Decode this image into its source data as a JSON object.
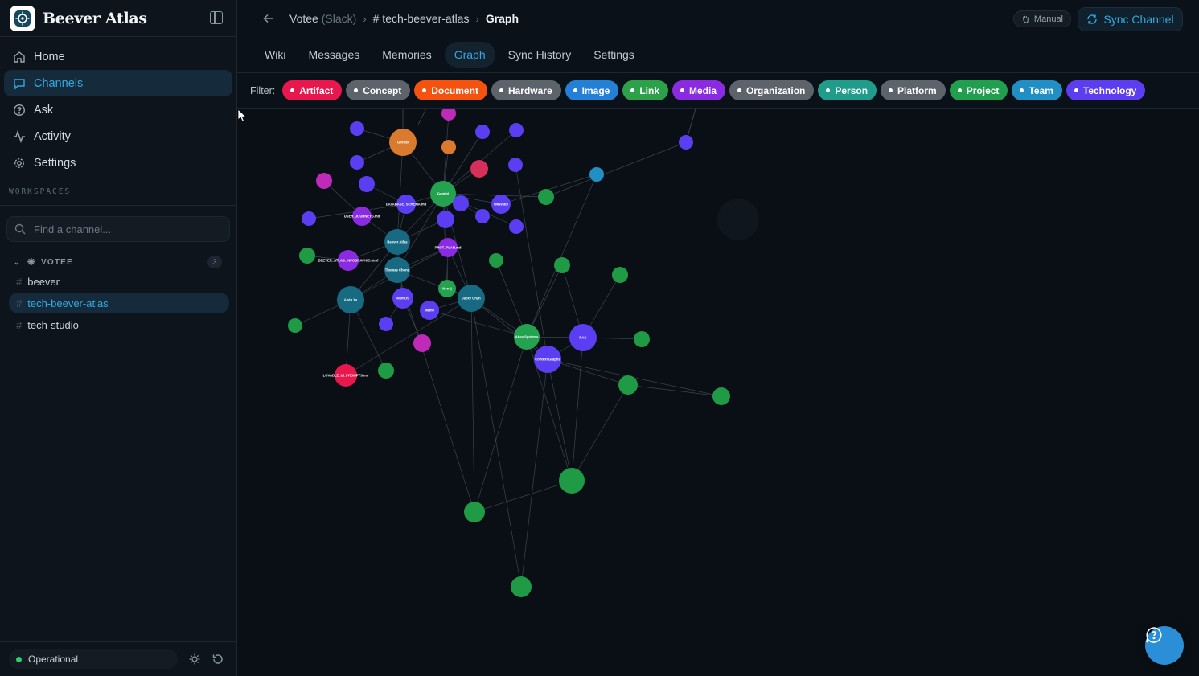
{
  "app": {
    "name": "Beever Atlas"
  },
  "nav": [
    {
      "label": "Home",
      "icon": "home-icon"
    },
    {
      "label": "Channels",
      "icon": "channels-icon",
      "active": true
    },
    {
      "label": "Ask",
      "icon": "help-circle-icon"
    },
    {
      "label": "Activity",
      "icon": "activity-icon"
    },
    {
      "label": "Settings",
      "icon": "gear-icon"
    }
  ],
  "workspaces_label": "WORKSPACES",
  "channel_search": {
    "placeholder": "Find a channel..."
  },
  "workspace": {
    "name": "VOTEE",
    "count": "3"
  },
  "channels": [
    "beever",
    "tech-beever-atlas",
    "tech-studio"
  ],
  "active_channel": "tech-beever-atlas",
  "status": {
    "label": "Operational",
    "color": "#2ecc71"
  },
  "breadcrumb": {
    "workspace": "Votee",
    "platform": "(Slack)",
    "channel": "# tech-beever-atlas",
    "page": "Graph"
  },
  "header": {
    "manual_label": "Manual",
    "sync_label": "Sync Channel"
  },
  "tabs": [
    "Wiki",
    "Messages",
    "Memories",
    "Graph",
    "Sync History",
    "Settings"
  ],
  "active_tab": "Graph",
  "filter": {
    "label": "Filter:",
    "chips": [
      {
        "label": "Artifact",
        "color": "#e8174e"
      },
      {
        "label": "Concept",
        "color": "#5c636b"
      },
      {
        "label": "Document",
        "color": "#f5520f"
      },
      {
        "label": "Hardware",
        "color": "#5c636b"
      },
      {
        "label": "Image",
        "color": "#2380d6"
      },
      {
        "label": "Link",
        "color": "#2da14a"
      },
      {
        "label": "Media",
        "color": "#8a2be2"
      },
      {
        "label": "Organization",
        "color": "#5c636b"
      },
      {
        "label": "Person",
        "color": "#1f9d8a"
      },
      {
        "label": "Platform",
        "color": "#5c636b"
      },
      {
        "label": "Project",
        "color": "#20a04f"
      },
      {
        "label": "Team",
        "color": "#1f8fc4"
      },
      {
        "label": "Technology",
        "color": "#5d3df0"
      }
    ]
  },
  "graph": {
    "node_labels": {
      "n1": "Beever Atlas",
      "n2": "Thomas Chong",
      "n3": "Jacky Chan",
      "n4": "Alvin Yu",
      "n5": "Atlas Systems",
      "n6": "RAG",
      "n7": "Context Graphs",
      "n8": "Gemini",
      "n9": "GitHub",
      "n10": "LOVABLE_UI_PROMPTS.md",
      "n11": "BEEVER_ATLAS_INFOGRAPHIC.html",
      "n12": "DATABASE_SCHEMA.md",
      "n13": "USER_JOURNEYS.md",
      "n14": "PROT_PLAN.md",
      "n15": "MemOS",
      "n16": "Mem0",
      "n17": "Neo4j",
      "n18": "Weaviate"
    }
  }
}
